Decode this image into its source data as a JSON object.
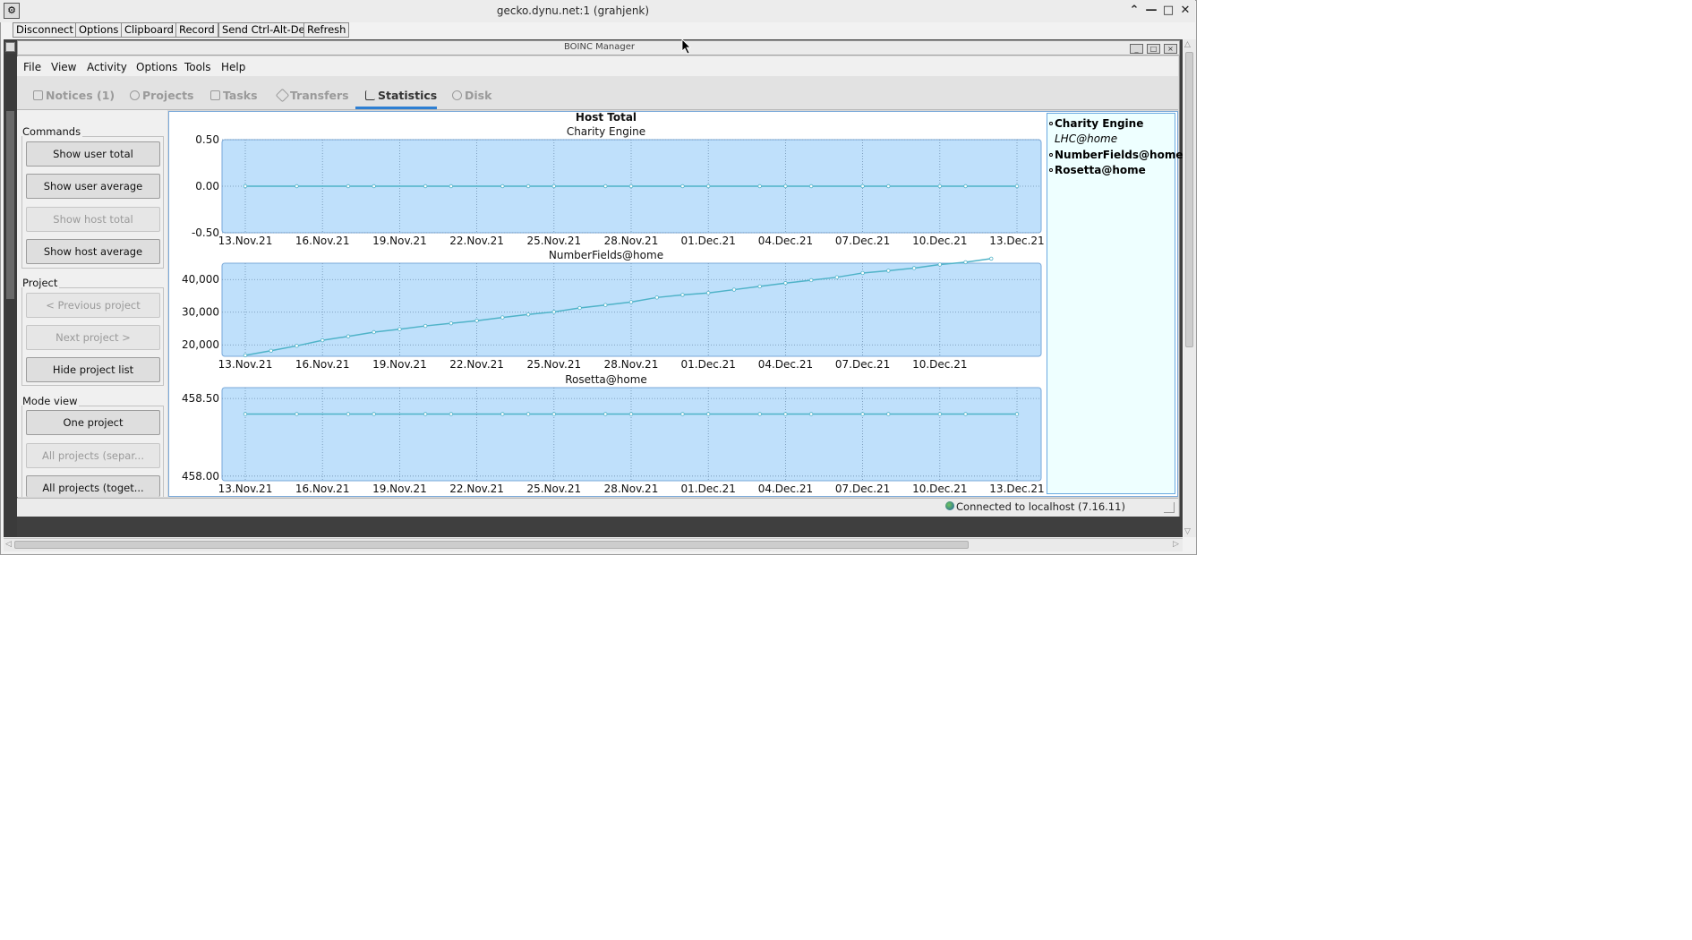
{
  "vnc": {
    "title": "gecko.dynu.net:1 (grahjenk)",
    "toolbar": [
      "Disconnect",
      "Options",
      "Clipboard",
      "Record",
      "Send Ctrl-Alt-Del",
      "Refresh"
    ]
  },
  "boinc": {
    "window_title": "BOINC Manager",
    "menu": [
      "File",
      "View",
      "Activity",
      "Options",
      "Tools",
      "Help"
    ],
    "tabs": [
      {
        "label": "Notices (1)",
        "icon": "envelope-icon"
      },
      {
        "label": "Projects",
        "icon": "gear-icon"
      },
      {
        "label": "Tasks",
        "icon": "document-icon"
      },
      {
        "label": "Transfers",
        "icon": "transfer-icon"
      },
      {
        "label": "Statistics",
        "icon": "bar-chart-icon",
        "active": true
      },
      {
        "label": "Disk",
        "icon": "pie-icon"
      }
    ],
    "commands": {
      "label": "Commands",
      "buttons": [
        {
          "label": "Show user total",
          "enabled": true
        },
        {
          "label": "Show user average",
          "enabled": true
        },
        {
          "label": "Show host total",
          "enabled": false
        },
        {
          "label": "Show host average",
          "enabled": true
        }
      ]
    },
    "project": {
      "label": "Project",
      "buttons": [
        {
          "label": "< Previous project",
          "enabled": false
        },
        {
          "label": "Next project >",
          "enabled": false
        },
        {
          "label": "Hide project list",
          "enabled": true
        }
      ]
    },
    "mode_view": {
      "label": "Mode view",
      "buttons": [
        {
          "label": "One project",
          "enabled": true
        },
        {
          "label": "All projects (separ...",
          "enabled": false
        },
        {
          "label": "All projects (toget...",
          "enabled": true
        }
      ]
    },
    "legend": [
      {
        "label": "Charity Engine",
        "style": "bold"
      },
      {
        "label": "LHC@home",
        "style": "italic"
      },
      {
        "label": "NumberFields@home",
        "style": "bold"
      },
      {
        "label": "Rosetta@home",
        "style": "bold"
      }
    ],
    "status": "Connected to localhost (7.16.11)"
  },
  "chart_data": {
    "type": "line",
    "title": "Host Total",
    "colors": {
      "plot_bg": "#bfe0fb",
      "line": "#4fb3c8"
    },
    "charts": [
      {
        "subtitle": "Charity Engine",
        "x_ticks": [
          "13.Nov.21",
          "16.Nov.21",
          "19.Nov.21",
          "22.Nov.21",
          "25.Nov.21",
          "28.Nov.21",
          "01.Dec.21",
          "04.Dec.21",
          "07.Dec.21",
          "10.Dec.21",
          "13.Dec.21"
        ],
        "y_ticks": [
          "0.50",
          "0.00",
          "-0.50"
        ],
        "ylim": [
          -0.5,
          0.5
        ],
        "x_days": [
          0,
          2,
          4,
          5,
          7,
          8,
          10,
          11,
          12,
          14,
          15,
          17,
          18,
          20,
          21,
          22,
          24,
          25,
          27,
          28,
          30
        ],
        "values": [
          0,
          0,
          0,
          0,
          0,
          0,
          0,
          0,
          0,
          0,
          0,
          0,
          0,
          0,
          0,
          0,
          0,
          0,
          0,
          0,
          0
        ]
      },
      {
        "subtitle": "NumberFields@home",
        "x_ticks": [
          "13.Nov.21",
          "16.Nov.21",
          "19.Nov.21",
          "22.Nov.21",
          "25.Nov.21",
          "28.Nov.21",
          "01.Dec.21",
          "04.Dec.21",
          "07.Dec.21",
          "10.Dec.21"
        ],
        "y_ticks": [
          "40,000",
          "30,000",
          "20,000"
        ],
        "ylim": [
          16500,
          45000
        ],
        "x_days": [
          0,
          1,
          2,
          3,
          4,
          5,
          6,
          7,
          8,
          9,
          10,
          11,
          12,
          13,
          14,
          15,
          16,
          17,
          18,
          19,
          20,
          21,
          22,
          23,
          24,
          25,
          26,
          27,
          28,
          29
        ],
        "values": [
          16800,
          18200,
          19700,
          21400,
          22600,
          23900,
          24800,
          25800,
          26600,
          27400,
          28400,
          29300,
          30100,
          31300,
          32200,
          33100,
          34500,
          35300,
          35900,
          36900,
          37900,
          38900,
          39800,
          40700,
          42000,
          42700,
          43500,
          44600,
          45300,
          46400
        ]
      },
      {
        "subtitle": "Rosetta@home",
        "x_ticks": [
          "13.Nov.21",
          "16.Nov.21",
          "19.Nov.21",
          "22.Nov.21",
          "25.Nov.21",
          "28.Nov.21",
          "01.Dec.21",
          "04.Dec.21",
          "07.Dec.21",
          "10.Dec.21",
          "13.Dec.21"
        ],
        "y_ticks": [
          "458.50",
          "458.00"
        ],
        "ylim": [
          457.97,
          458.57
        ],
        "x_days": [
          0,
          2,
          4,
          5,
          7,
          8,
          10,
          11,
          12,
          14,
          15,
          17,
          18,
          20,
          21,
          22,
          24,
          25,
          27,
          28,
          30
        ],
        "values": [
          458.4,
          458.4,
          458.4,
          458.4,
          458.4,
          458.4,
          458.4,
          458.4,
          458.4,
          458.4,
          458.4,
          458.4,
          458.4,
          458.4,
          458.4,
          458.4,
          458.4,
          458.4,
          458.4,
          458.4,
          458.4
        ]
      }
    ]
  }
}
